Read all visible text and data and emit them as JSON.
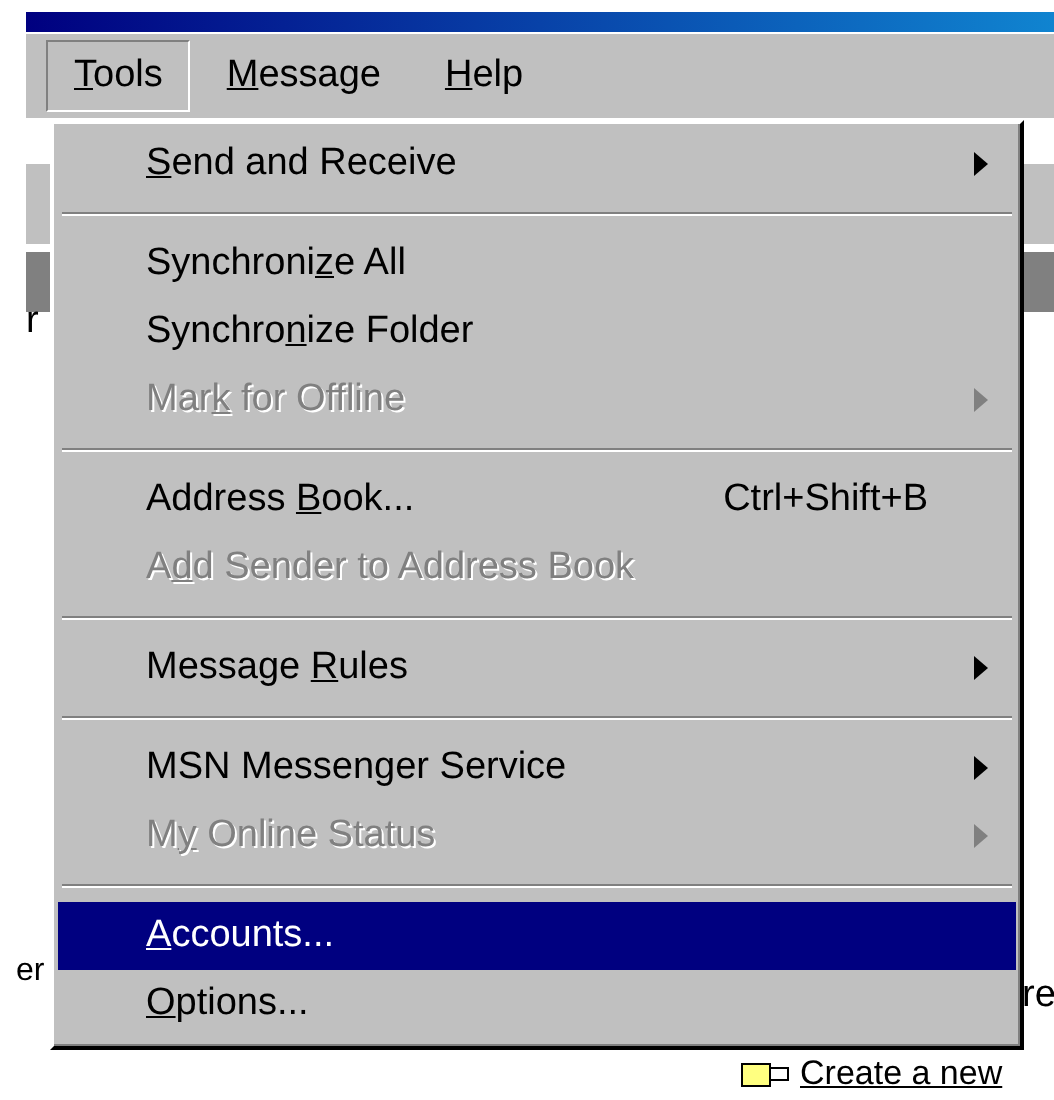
{
  "menu_bar": [
    {
      "label": {
        "key": "T",
        "after": "ools"
      },
      "selected": true
    },
    {
      "label": {
        "key": "M",
        "after": "essage"
      },
      "selected": false
    },
    {
      "label": {
        "key": "H",
        "after": "elp"
      },
      "selected": false
    }
  ],
  "menu": [
    {
      "kind": "item",
      "label": {
        "key": "S",
        "after": "end and Receive"
      },
      "submenu": true,
      "disabled": false,
      "selected": false
    },
    {
      "kind": "separator"
    },
    {
      "kind": "item",
      "label": {
        "before": "Synchroni",
        "key": "z",
        "after": "e All"
      },
      "submenu": false,
      "disabled": false,
      "selected": false
    },
    {
      "kind": "item",
      "label": {
        "before": "Synchro",
        "key": "n",
        "after": "ize Folder"
      },
      "submenu": false,
      "disabled": false,
      "selected": false
    },
    {
      "kind": "item",
      "label": {
        "before": "Mar",
        "key": "k",
        "after": " for Offline"
      },
      "submenu": true,
      "disabled": true,
      "selected": false
    },
    {
      "kind": "separator"
    },
    {
      "kind": "item",
      "label": {
        "before": "Address ",
        "key": "B",
        "after": "ook..."
      },
      "shortcut": "Ctrl+Shift+B",
      "submenu": false,
      "disabled": false,
      "selected": false
    },
    {
      "kind": "item",
      "label": {
        "before": "A",
        "key": "d",
        "after": "d Sender to Address Book"
      },
      "submenu": false,
      "disabled": true,
      "selected": false
    },
    {
      "kind": "separator"
    },
    {
      "kind": "item",
      "label": {
        "before": "Message ",
        "key": "R",
        "after": "ules"
      },
      "submenu": true,
      "disabled": false,
      "selected": false
    },
    {
      "kind": "separator"
    },
    {
      "kind": "item",
      "label": {
        "before": "MSN Messenger Service"
      },
      "submenu": true,
      "disabled": false,
      "selected": false
    },
    {
      "kind": "item",
      "label": {
        "before": "M",
        "key": "y",
        "after": " Online Status"
      },
      "submenu": true,
      "disabled": true,
      "selected": false
    },
    {
      "kind": "separator"
    },
    {
      "kind": "item",
      "label": {
        "key": "A",
        "after": "ccounts..."
      },
      "submenu": false,
      "disabled": false,
      "selected": true
    },
    {
      "kind": "item",
      "label": {
        "key": "O",
        "after": "ptions..."
      },
      "submenu": false,
      "disabled": false,
      "selected": false
    }
  ],
  "background": {
    "fragment_left_top": "r",
    "fragment_left_bottom": "er",
    "fragment_right": "re",
    "link": "Create a new"
  }
}
